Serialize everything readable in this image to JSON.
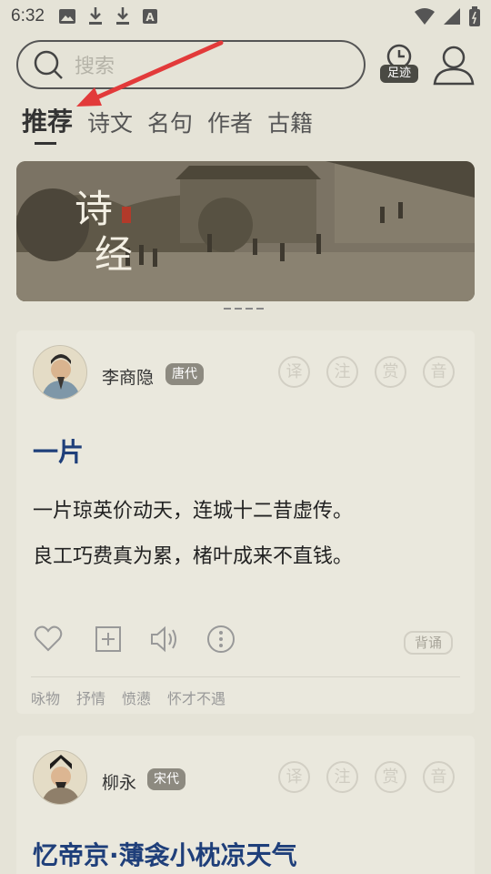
{
  "status": {
    "time": "6:32",
    "icons": [
      "image-icon",
      "download-icon",
      "download-icon",
      "font-icon"
    ],
    "right_icons": [
      "wifi-icon",
      "signal-icon",
      "battery-icon"
    ]
  },
  "search": {
    "placeholder": "搜索"
  },
  "header": {
    "footprint_label": "足迹"
  },
  "tabs": [
    {
      "label": "推荐",
      "active": true
    },
    {
      "label": "诗文",
      "active": false
    },
    {
      "label": "名句",
      "active": false
    },
    {
      "label": "作者",
      "active": false
    },
    {
      "label": "古籍",
      "active": false
    }
  ],
  "banner": {
    "title_1": "诗",
    "title_2": "经"
  },
  "tool_labels": [
    "译",
    "注",
    "赏",
    "音"
  ],
  "cards": [
    {
      "author": "李商隐",
      "dynasty": "唐代",
      "title": "一片",
      "lines": [
        "一片琼英价动天，连城十二昔虚传。",
        "良工巧费真为累，楮叶成来不直钱。"
      ],
      "recite_label": "背诵",
      "tags": [
        "咏物",
        "抒情",
        "愤懑",
        "怀才不遇"
      ]
    },
    {
      "author": "柳永",
      "dynasty": "宋代",
      "title": "忆帝京·薄衾小枕凉天气"
    }
  ],
  "colors": {
    "background": "#e5e3d7",
    "title_blue": "#1f3f7a",
    "annotation_red": "#e23a3a"
  }
}
